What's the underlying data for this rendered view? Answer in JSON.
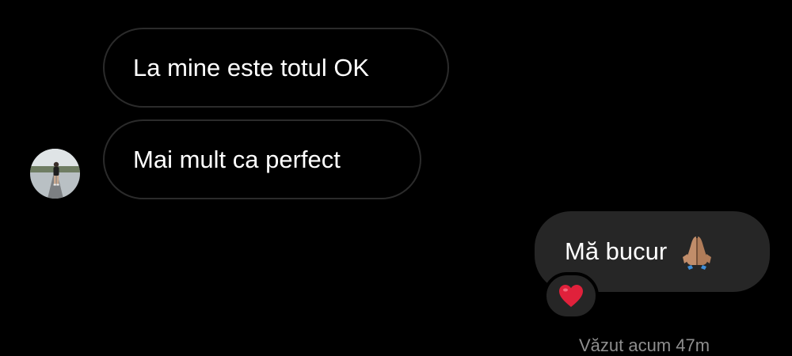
{
  "conversation": {
    "messages": [
      {
        "direction": "received",
        "text": "La mine este totul OK"
      },
      {
        "direction": "received",
        "text": "Mai mult ca perfect"
      },
      {
        "direction": "sent",
        "text": "Mă bucur",
        "emoji": "folded-hands"
      }
    ],
    "sender_avatar": {
      "icon": "profile-photo-avatar"
    },
    "reaction": {
      "emoji": "red-heart",
      "color": "#e0213b"
    },
    "seen_status": "Văzut acum 47m"
  },
  "colors": {
    "background": "#000000",
    "received_bubble_border": "#2b2b2b",
    "sent_bubble_fill": "#262626",
    "text": "#ffffff",
    "muted_text": "#8e8e8e"
  }
}
